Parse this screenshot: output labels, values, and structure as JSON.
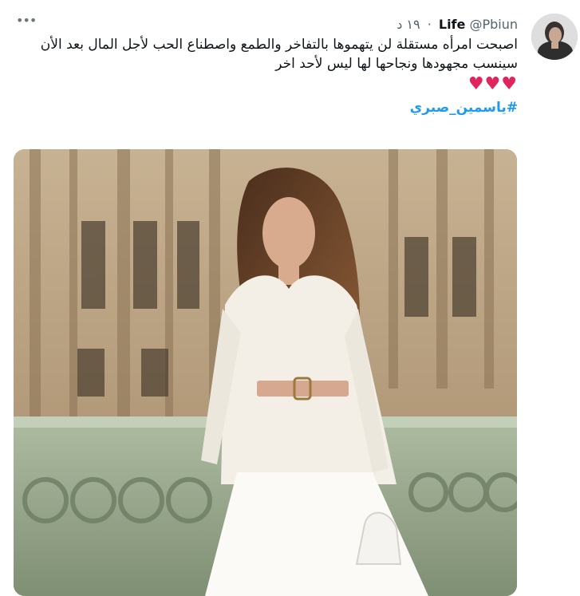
{
  "tweet": {
    "author_name": "Life",
    "handle": "@Pbiun",
    "separator": "·",
    "timestamp": "١٩ د",
    "text_line_1": "اصبحت امرأه مستقلة لن يتهموها بالتفاخر والطمع واصطناع الحب لأجل المال بعد الأن",
    "text_line_2": "سينسب مجهودها ونجاحها لها ليس لأحد اخر",
    "hearts": "♥♥♥",
    "hashtag": "#ياسمين_صبري"
  },
  "icons": {
    "more": "more-horizontal-icon",
    "avatar": "avatar"
  },
  "colors": {
    "name": "#0f1419",
    "meta": "#536471",
    "hashtag": "#1d9bf0",
    "heart": "#e0245e"
  }
}
